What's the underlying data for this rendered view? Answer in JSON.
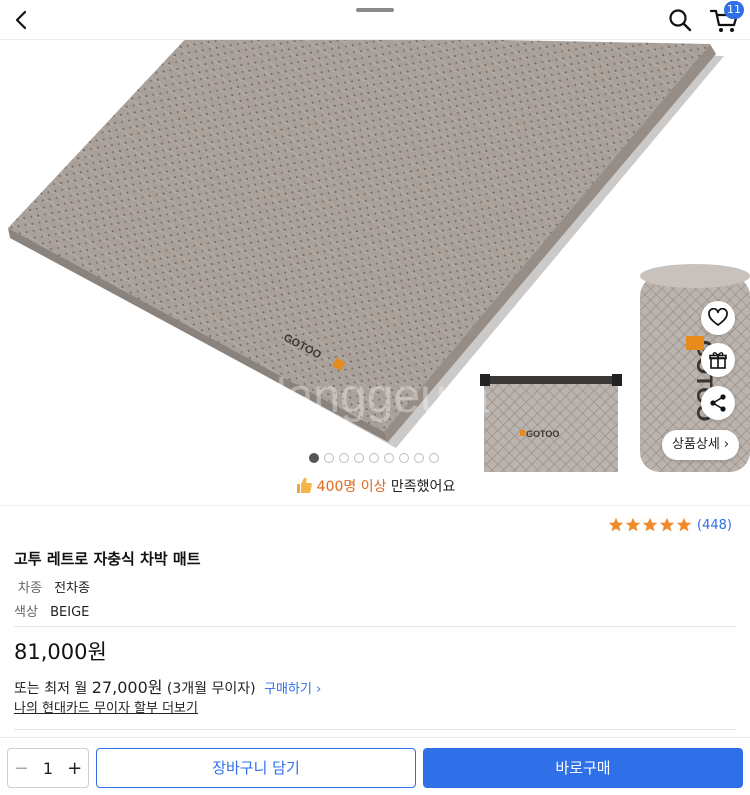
{
  "header": {
    "cart_count": "11",
    "icons": {
      "back": "chevron-left-icon",
      "search": "search-icon",
      "cart": "cart-icon"
    }
  },
  "gallery": {
    "watermark": "danggeura",
    "detail_button_label": "상품상세",
    "slide_count": 9,
    "active_slide": 1
  },
  "satisfaction": {
    "highlight": "400명 이상",
    "rest": " 만족했어요"
  },
  "rating": {
    "stars": 5,
    "review_count": "(448)",
    "star_color": "#f08a2a"
  },
  "product": {
    "title": "고투 레트로 자충식 차박 매트",
    "options": [
      {
        "label": "차종",
        "value": "전차종"
      },
      {
        "label": "색상",
        "value": "BEIGE"
      }
    ],
    "price": "81,000원",
    "installment_prefix": "또는 최저 월 ",
    "installment_amount": "27,000원",
    "installment_suffix": " (3개월 무이자)",
    "buy_link": "구매하기",
    "card_link": "나의 현대카드 무이자 할부 더보기"
  },
  "bottom_bar": {
    "quantity": "1",
    "add_to_cart": "장바구니 담기",
    "buy_now": "바로구매"
  },
  "colors": {
    "accent": "#2f6fe8",
    "highlight": "#e2681e",
    "mat": "#a79d95"
  }
}
